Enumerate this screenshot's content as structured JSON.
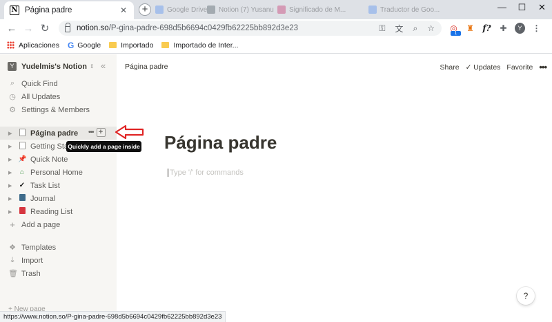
{
  "browser": {
    "active_tab_title": "Página padre",
    "background_tabs": [
      {
        "label": "Google Drive",
        "color": "#4285f4"
      },
      {
        "label": "Notion (7) Yusanu",
        "color": "#37474f"
      },
      {
        "label": "Significado de M...",
        "color": "#c2185b"
      },
      {
        "label": "Traductor de Goo...",
        "color": "#4285f4"
      }
    ],
    "url_host": "notion.so",
    "url_path": "/P-gina-padre-698d5b6694c0429fb62225bb892d3e23",
    "profile_initial": "Y",
    "extension_badge": "1",
    "bookmarks": [
      {
        "label": "Aplicaciones",
        "icon": "apps-grid-icon"
      },
      {
        "label": "Google",
        "icon": "google-icon"
      },
      {
        "label": "Importado",
        "icon": "folder-icon"
      },
      {
        "label": "Importado de Inter...",
        "icon": "folder-icon"
      }
    ],
    "status_url": "https://www.notion.so/P-gina-padre-698d5b6694c0429fb62225bb892d3e23"
  },
  "sidebar": {
    "workspace_initial": "Y",
    "workspace_name": "Yudelmis's Notion",
    "nav": [
      {
        "label": "Quick Find",
        "icon": "search-icon"
      },
      {
        "label": "All Updates",
        "icon": "clock-icon"
      },
      {
        "label": "Settings & Members",
        "icon": "gear-icon"
      }
    ],
    "pages": [
      {
        "label": "Página padre",
        "icon": "page-icon"
      },
      {
        "label": "Getting Started",
        "icon": "page-icon"
      },
      {
        "label": "Quick Note",
        "icon": "pin-icon"
      },
      {
        "label": "Personal Home",
        "icon": "house-icon"
      },
      {
        "label": "Task List",
        "icon": "check-icon"
      },
      {
        "label": "Journal",
        "icon": "journal-icon"
      },
      {
        "label": "Reading List",
        "icon": "book-icon"
      }
    ],
    "add_page": "Add a page",
    "tools": [
      {
        "label": "Templates",
        "icon": "templates-icon"
      },
      {
        "label": "Import",
        "icon": "import-icon"
      },
      {
        "label": "Trash",
        "icon": "trash-icon"
      }
    ],
    "new_page": "New page",
    "tooltip": "Quickly add a page inside"
  },
  "topbar": {
    "breadcrumb": "Página padre",
    "share": "Share",
    "updates": "Updates",
    "favorite": "Favorite"
  },
  "page": {
    "title": "Página padre",
    "placeholder": "Type '/' for commands"
  },
  "help_label": "?",
  "colors": {
    "sidebar_bg": "#f7f6f3",
    "text": "#37352f",
    "arrow_red": "#e02424"
  }
}
